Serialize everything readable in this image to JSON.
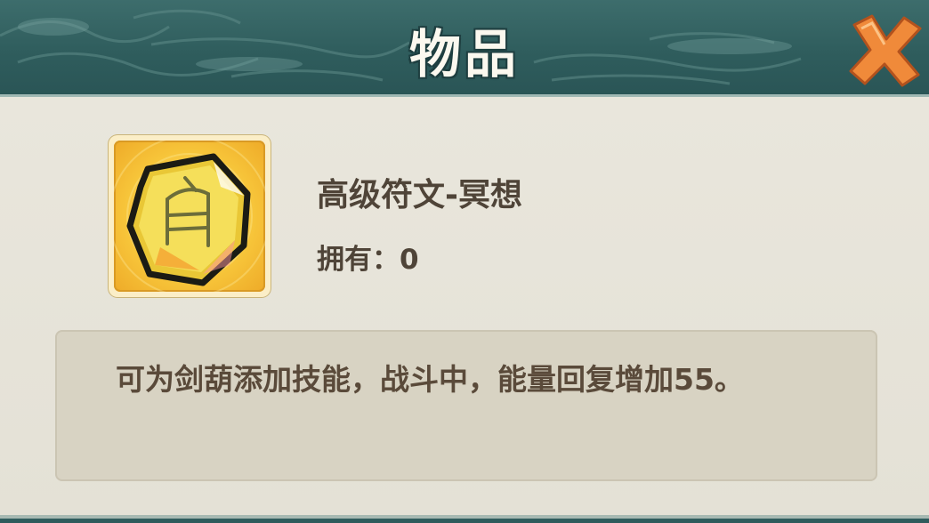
{
  "dialog": {
    "title": "物品",
    "close_icon": "close-x-icon"
  },
  "item": {
    "icon": "rune-stone-icon",
    "glyph_icon": "moon-glyph-icon",
    "name": "高级符文-冥想",
    "own_label": "拥有：",
    "own_count": "0",
    "description": "可为剑葫添加技能，战斗中，能量回复增加55。"
  },
  "colors": {
    "header_bg": "#2f5c5d",
    "title_text": "#fbf8ef",
    "panel_bg": "#e7e4da",
    "text": "#4f4438",
    "close_orange": "#f08a3a",
    "rune_gold": "#f2c232"
  }
}
